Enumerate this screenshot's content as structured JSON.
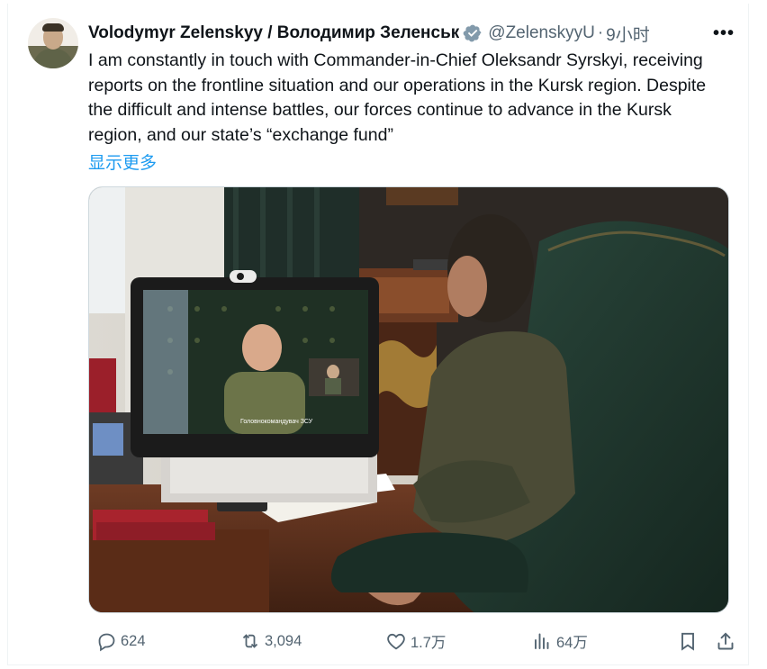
{
  "tweet": {
    "display_name": "Volodymyr Zelenskyy / Володимир Зеленськ",
    "handle": "@ZelenskyyU",
    "separator": "·",
    "time": "9小时",
    "more_label": "•••",
    "text": "I am constantly in touch with Commander-in-Chief Oleksandr Syrskyi, receiving reports on the frontline situation and our operations in the Kursk region. Despite the difficult and intense battles, our forces continue to advance in the Kursk region, and our state’s “exchange fund”",
    "show_more": "显示更多",
    "photo_caption_text": "Головнокомандувач ЗСУ"
  },
  "actions": {
    "replies": "624",
    "retweets": "3,094",
    "likes": "1.7万",
    "views": "64万"
  },
  "colors": {
    "accent": "#1d9bf0",
    "secondary_text": "#536471",
    "verified_badge": "#829aab"
  }
}
